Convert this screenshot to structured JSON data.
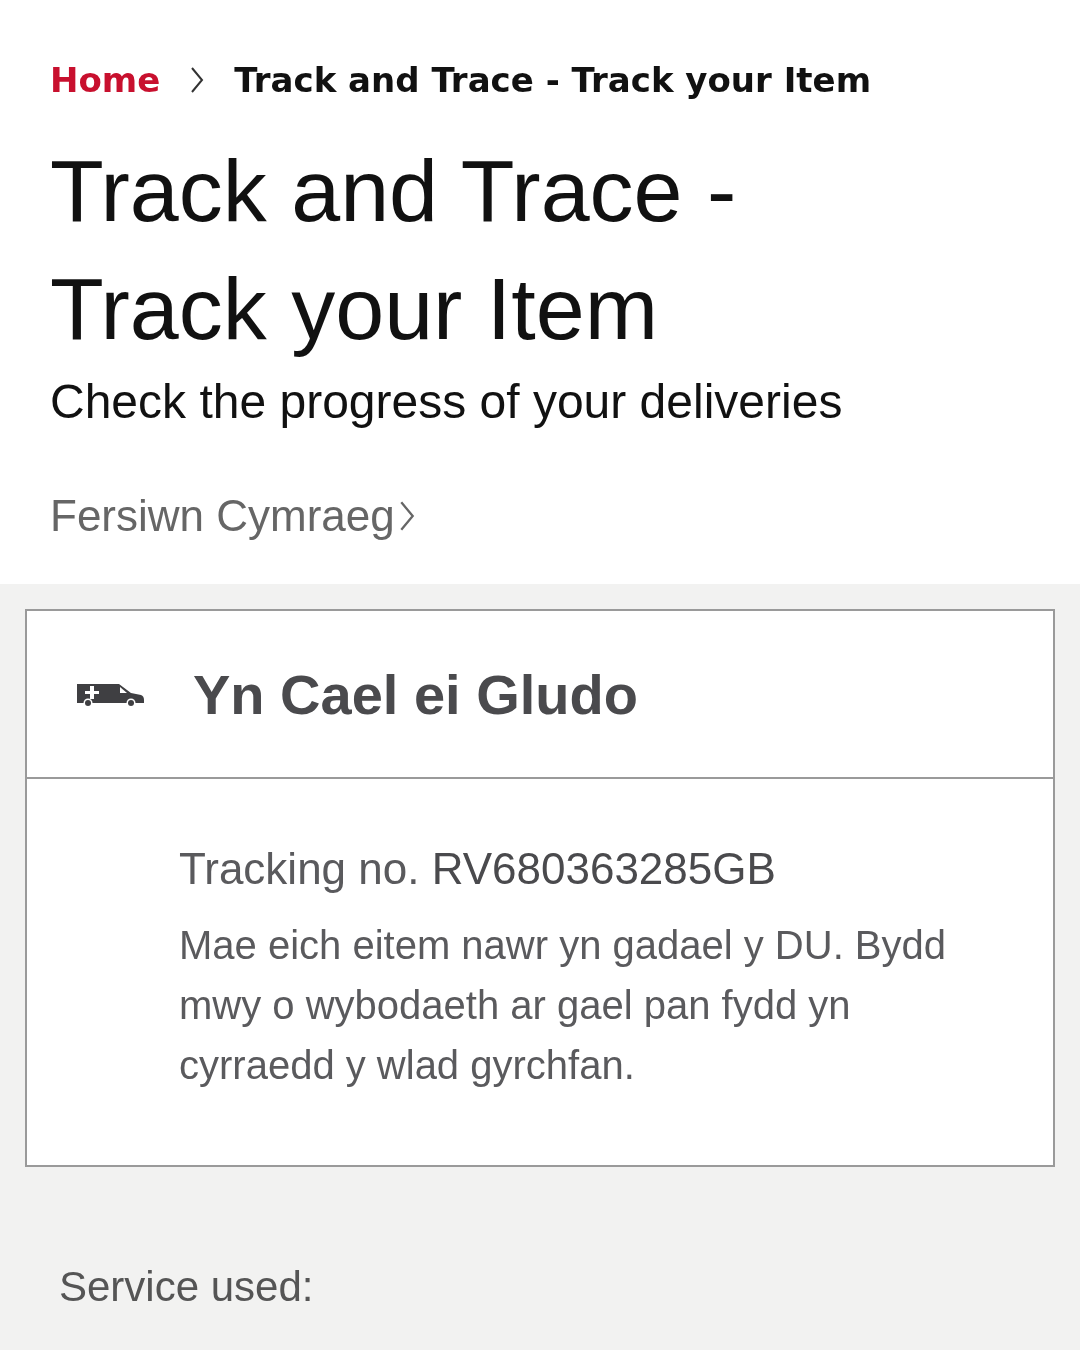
{
  "breadcrumb": [
    {
      "label": "Home",
      "kind": "link"
    },
    {
      "label": "Track and Trace - Track your Item",
      "kind": "current"
    }
  ],
  "title": "Track and Trace - Track your Item",
  "subtitle": "Check the progress of your deliveries",
  "language_link": {
    "label": "Fersiwn Cymraeg"
  },
  "status_card": {
    "status": "Yn Cael ei Gludo",
    "tracking_label": "Tracking no.",
    "tracking_number": "RV680363285GB",
    "message": "Mae eich eitem nawr yn gadael y DU. Bydd mwy o wybodaeth ar gael pan fydd yn cyrraedd y wlad gyrchfan."
  },
  "service_label": "Service used:"
}
